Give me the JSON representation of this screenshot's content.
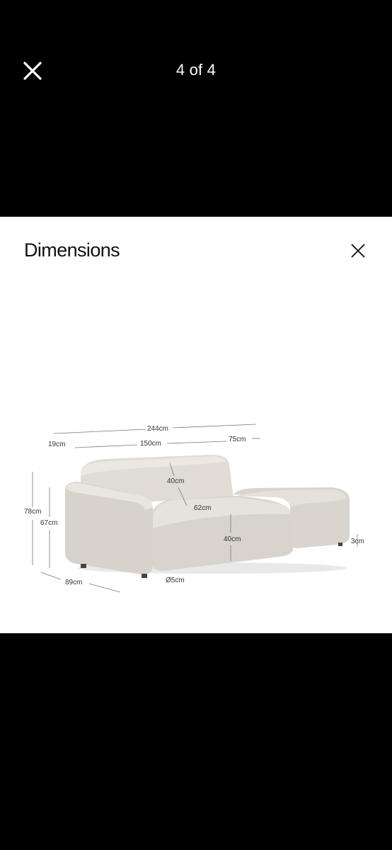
{
  "viewer": {
    "counter": "4 of 4",
    "close_icon": "close-icon"
  },
  "image": {
    "title": "Dimensions",
    "close_icon": "close-x-icon",
    "dimensions": {
      "total_width": "244cm",
      "arm_width": "19cm",
      "seat_width": "150cm",
      "ottoman_width": "75cm",
      "back_height": "40cm",
      "seat_depth": "62cm",
      "total_height": "78cm",
      "arm_height": "67cm",
      "seat_height": "40cm",
      "depth": "89cm",
      "leg_diameter": "Ø5cm",
      "leg_height": "3cm"
    }
  }
}
